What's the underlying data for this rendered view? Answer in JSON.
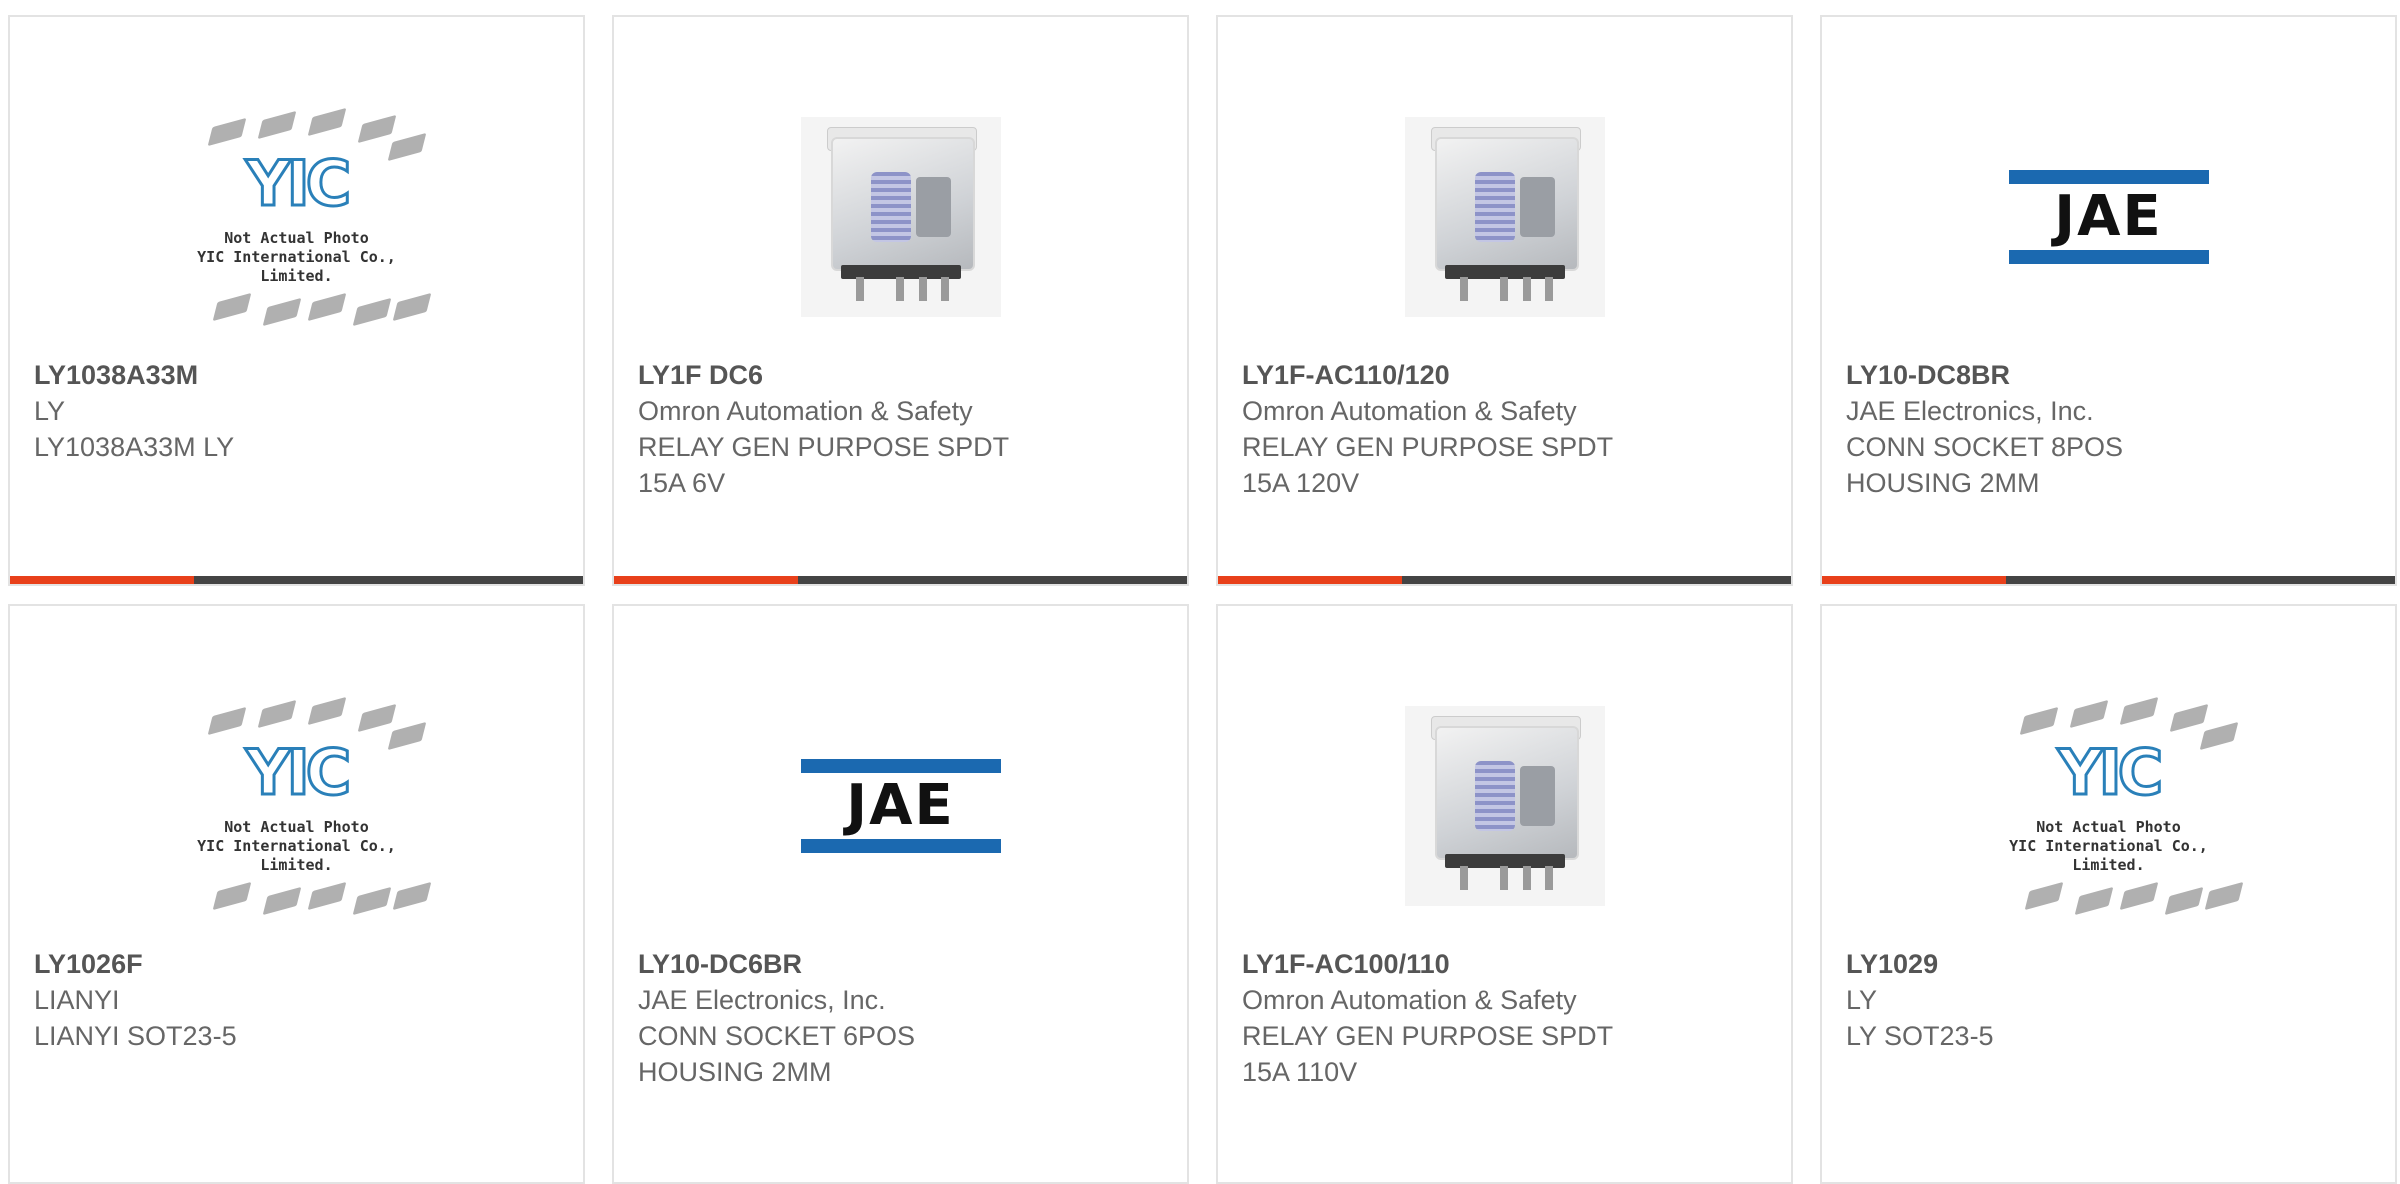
{
  "accent_colors": {
    "red": "#e8401a",
    "dark": "#444444",
    "jae_blue": "#1b69b0"
  },
  "products": [
    {
      "part": "LY1038A33M",
      "lines": [
        "LY",
        "LY1038A33M LY"
      ],
      "image": "yic-placeholder",
      "placeholder": {
        "brand": "YIC",
        "note1": "Not Actual Photo",
        "note2": "YIC International Co., Limited."
      }
    },
    {
      "part": "LY1F DC6",
      "lines": [
        "Omron Automation & Safety",
        "RELAY GEN PURPOSE SPDT",
        "15A 6V"
      ],
      "image": "relay-photo"
    },
    {
      "part": "LY1F-AC110/120",
      "lines": [
        "Omron Automation & Safety",
        "RELAY GEN PURPOSE SPDT",
        "15A 120V"
      ],
      "image": "relay-photo"
    },
    {
      "part": "LY10-DC8BR",
      "lines": [
        "JAE Electronics, Inc.",
        "CONN SOCKET 8POS",
        "HOUSING 2MM"
      ],
      "image": "jae-logo",
      "logo_text": "JAE"
    },
    {
      "part": "LY1026F",
      "lines": [
        "LIANYI",
        "LIANYI SOT23-5"
      ],
      "image": "yic-placeholder",
      "placeholder": {
        "brand": "YIC",
        "note1": "Not Actual Photo",
        "note2": "YIC International Co., Limited."
      }
    },
    {
      "part": "LY10-DC6BR",
      "lines": [
        "JAE Electronics, Inc.",
        "CONN SOCKET 6POS",
        "HOUSING 2MM"
      ],
      "image": "jae-logo",
      "logo_text": "JAE"
    },
    {
      "part": "LY1F-AC100/110",
      "lines": [
        "Omron Automation & Safety",
        "RELAY GEN PURPOSE SPDT",
        "15A 110V"
      ],
      "image": "relay-photo"
    },
    {
      "part": "LY1029",
      "lines": [
        "LY",
        "LY SOT23-5"
      ],
      "image": "yic-placeholder",
      "placeholder": {
        "brand": "YIC",
        "note1": "Not Actual Photo",
        "note2": "YIC International Co., Limited."
      }
    }
  ]
}
